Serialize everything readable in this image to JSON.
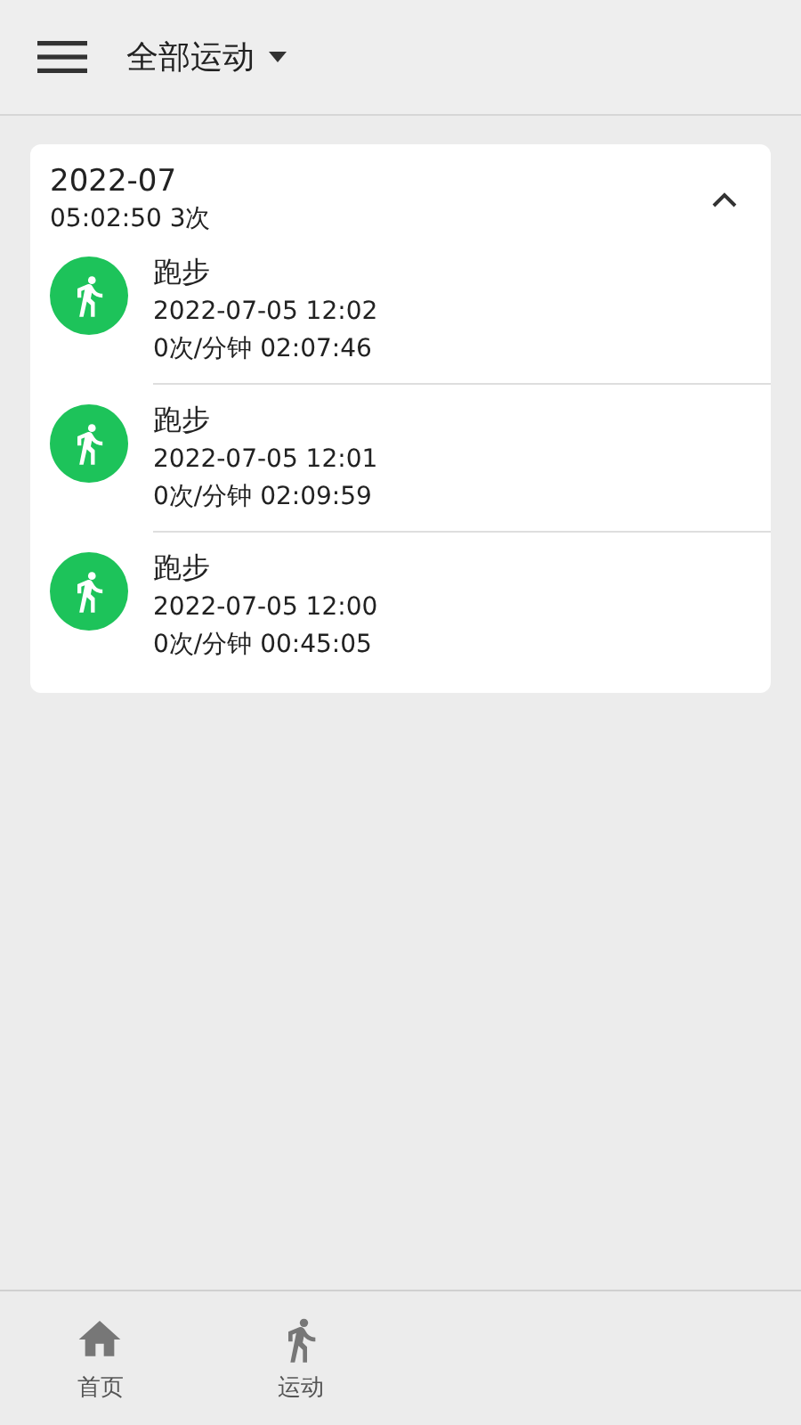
{
  "header": {
    "title": "全部运动"
  },
  "group": {
    "month": "2022-07",
    "summary": "05:02:50 3次",
    "expanded": true,
    "records": [
      {
        "name": "跑步",
        "time": "2022-07-05 12:02",
        "detail": "0次/分钟 02:07:46"
      },
      {
        "name": "跑步",
        "time": "2022-07-05 12:01",
        "detail": "0次/分钟 02:09:59"
      },
      {
        "name": "跑步",
        "time": "2022-07-05 12:00",
        "detail": "0次/分钟 00:45:05"
      }
    ]
  },
  "bottom_nav": [
    {
      "kind": "home",
      "label": "首页"
    },
    {
      "kind": "sport",
      "label": "运动"
    }
  ]
}
